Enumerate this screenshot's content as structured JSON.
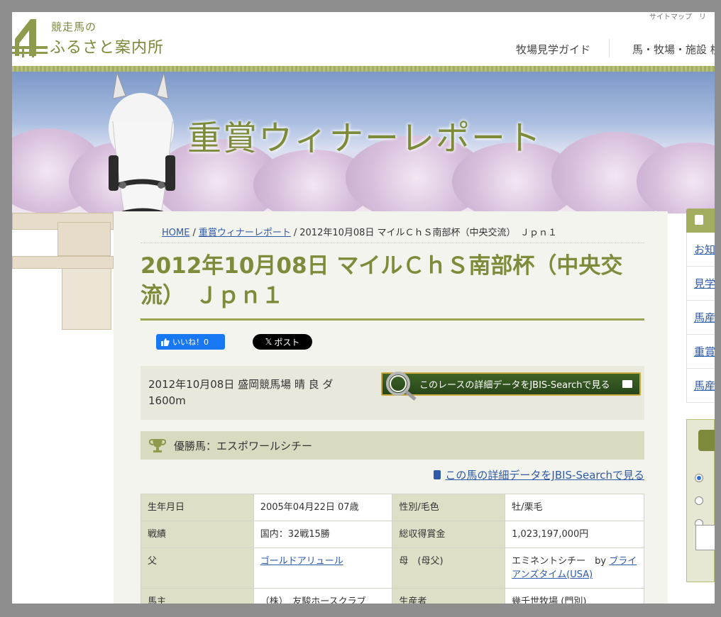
{
  "header": {
    "logo_sub": "競走馬の",
    "logo_main": "ふるさと案内所",
    "top_links": "サイトマップ　リ",
    "nav": [
      "牧場見学ガイド",
      "馬・牧場・施設 検"
    ]
  },
  "banner": {
    "title": "重賞ウィナーレポート"
  },
  "breadcrumb": {
    "home": "HOME",
    "section": "重賞ウィナーレポート",
    "current": "2012年10月08日 マイルＣｈＳ南部杯（中央交流）　Ｊｐｎ１"
  },
  "page_title": "2012年10月08日 マイルＣｈＳ南部杯（中央交流）　Ｊｐｎ１",
  "social": {
    "like_label": "いいね！0",
    "post_label": "ポスト"
  },
  "race": {
    "info": "2012年10月08日 盛岡競馬場 晴 良 ダ 1600m",
    "jbis_button": "このレースの詳細データをJBIS-Searchで見る"
  },
  "winner": {
    "label": "優勝馬：エスポワールシチー",
    "jbis_link": "この馬の詳細データをJBIS-Searchで見る"
  },
  "table": {
    "rows": [
      [
        "生年月日",
        "2005年04月22日 07歳",
        "性別/毛色",
        "牡/栗毛"
      ],
      [
        "戦績",
        "国内：32戦15勝",
        "総収得賞金",
        "1,023,197,000円"
      ],
      [
        "父",
        "ゴールドアリュール",
        "母　(母父)",
        "エミネントシチー　by"
      ],
      [
        "馬主",
        "（株）　友駿ホースクラブ",
        "生産者",
        "幾千世牧場 (門別)"
      ]
    ],
    "dam_sire_link": "ブライアンズタイム(USA)"
  },
  "sidebar": {
    "items": [
      "お知",
      "見学",
      "馬産",
      "重賞",
      "馬産"
    ]
  },
  "colors": {
    "accent_olive": "#7d8b3a",
    "link_blue": "#2f5aa8",
    "jbis_green": "#27451a",
    "facebook_blue": "#1877f2"
  }
}
